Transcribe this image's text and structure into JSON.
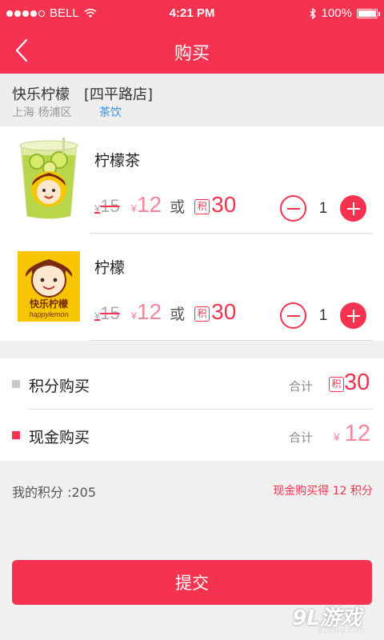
{
  "status_bar": {
    "carrier": "BELL",
    "time": "4:21 PM",
    "battery": "100%",
    "battery_level": 1.0,
    "signal_bars": 4
  },
  "nav": {
    "title": "购买",
    "back_icon": "chevron-left-icon"
  },
  "store": {
    "name": "快乐柠檬",
    "branch": "[四平路店]",
    "location": "上海 杨浦区",
    "category": "茶饮"
  },
  "products": [
    {
      "name": "柠檬茶",
      "original_price": "15",
      "price": "12",
      "or_label": "或",
      "points_badge": "积",
      "points_price": "30",
      "quantity": "1"
    },
    {
      "name": "柠檬",
      "original_price": "15",
      "price": "12",
      "or_label": "或",
      "points_badge": "积",
      "points_price": "30",
      "quantity": "1",
      "logo_text": "快乐柠檬",
      "logo_subtext": "happylemon"
    }
  ],
  "currency_symbol": "¥",
  "summary": {
    "points_row": {
      "label": "积分购买",
      "total_label": "合计",
      "badge": "积",
      "value": "30"
    },
    "cash_row": {
      "label": "现金购买",
      "total_label": "合计",
      "value": "12"
    }
  },
  "footer": {
    "my_points": "我的积分 :205",
    "cash_note": "现金购买得 12 积分",
    "submit_label": "提交"
  },
  "watermark": {
    "main": "9L游戏",
    "sub": "91danji.com"
  },
  "colors": {
    "brand": "#f5324f",
    "price_pink": "#f5879a",
    "link_blue": "#3a8ee6"
  }
}
